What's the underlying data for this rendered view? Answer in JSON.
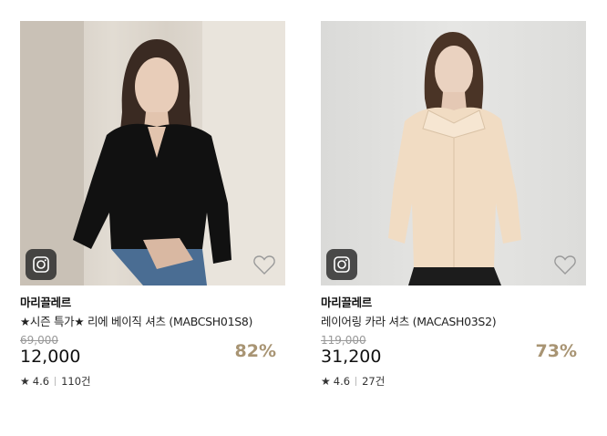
{
  "products": [
    {
      "brand": "마리끌레르",
      "name": "★시즌 특가★ 리에 베이직 셔츠 (MABCSH01S8)",
      "original_price": "69,000",
      "price": "12,000",
      "discount": "82%",
      "rating": "4.6",
      "reviews": "110건",
      "shirt_color": "#111111"
    },
    {
      "brand": "마리끌레르",
      "name": "레이어링 카라 셔츠 (MACASH03S2)",
      "original_price": "119,000",
      "price": "31,200",
      "discount": "73%",
      "rating": "4.6",
      "reviews": "27건",
      "shirt_color": "#f1dcc3"
    }
  ],
  "icons": {
    "camera": "camera-icon",
    "wishlist": "heart-icon",
    "rating": "star-icon"
  },
  "colors": {
    "discount": "#a89473",
    "original_price": "#999999"
  }
}
